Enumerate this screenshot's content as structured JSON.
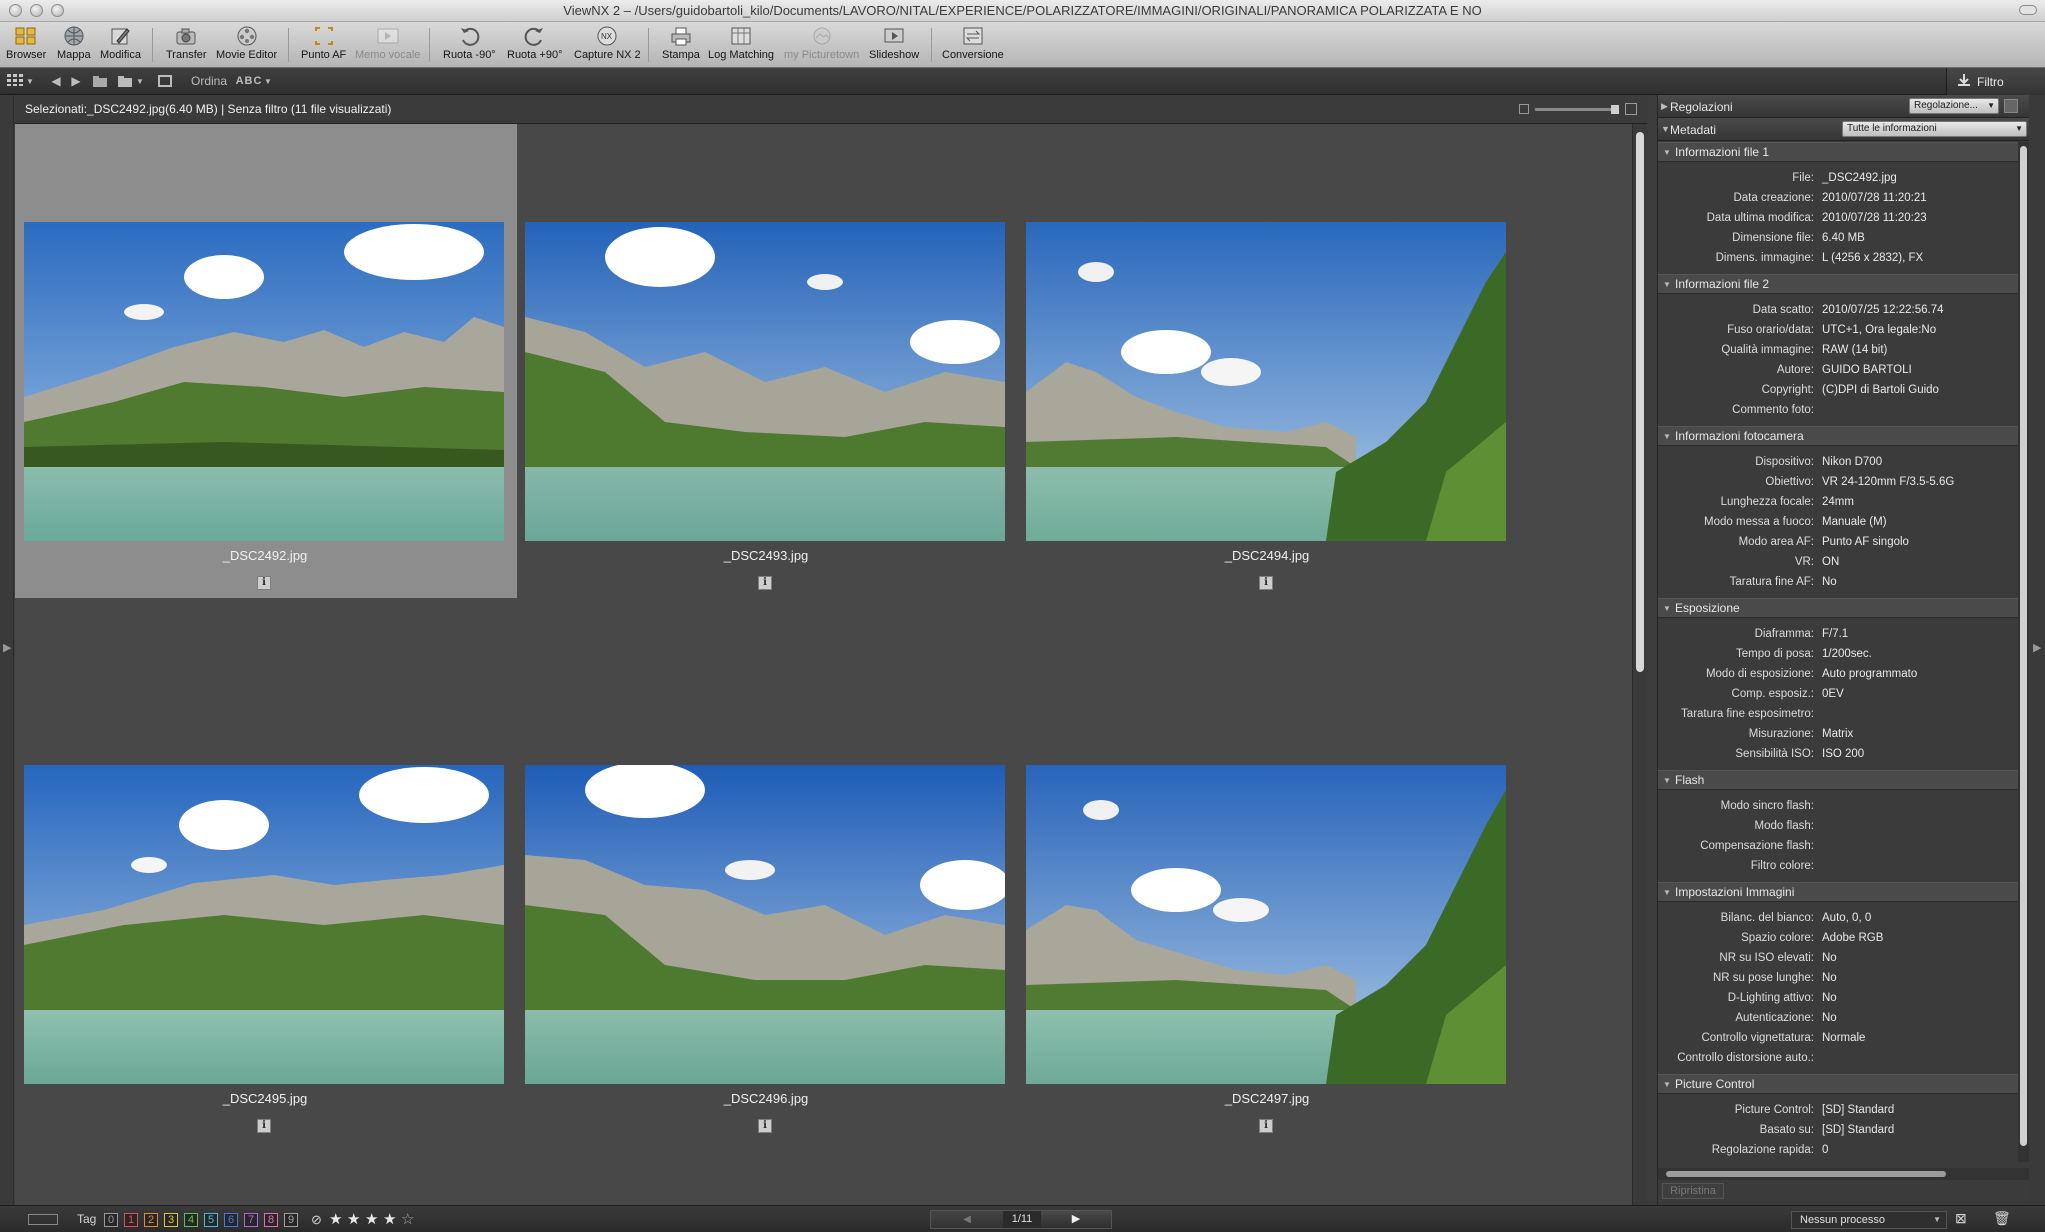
{
  "window": {
    "title": "ViewNX 2 – /Users/guidobartoli_kilo/Documents/LAVORO/NITAL/EXPERIENCE/POLARIZZATORE/IMMAGINI/ORIGINALI/PANORAMICA POLARIZZATA E NO"
  },
  "toolbar": {
    "browser": "Browser",
    "mappa": "Mappa",
    "modifica": "Modifica",
    "transfer": "Transfer",
    "movie_editor": "Movie Editor",
    "punto_af": "Punto AF",
    "memo_vocale": "Memo vocale",
    "ruota_left": "Ruota -90°",
    "ruota_right": "Ruota +90°",
    "capture_nx2": "Capture NX 2",
    "stampa": "Stampa",
    "log_matching": "Log Matching",
    "my_picturetown": "my Picturetown",
    "slideshow": "Slideshow",
    "conversione": "Conversione"
  },
  "toolbar2": {
    "ordina": "Ordina",
    "sort_value": "ABC",
    "filtro": "Filtro"
  },
  "content": {
    "selection_info": "Selezionati:_DSC2492.jpg(6.40 MB) | Senza filtro (11 file visualizzati)"
  },
  "thumbnails": [
    {
      "name": "_DSC2492.jpg",
      "selected": true
    },
    {
      "name": "_DSC2493.jpg",
      "selected": false
    },
    {
      "name": "_DSC2494.jpg",
      "selected": false
    },
    {
      "name": "_DSC2495.jpg",
      "selected": false
    },
    {
      "name": "_DSC2496.jpg",
      "selected": false
    },
    {
      "name": "_DSC2497.jpg",
      "selected": false
    }
  ],
  "panel": {
    "regolazioni": "Regolazioni",
    "regolazioni_dd": "Regolazione...",
    "metadati": "Metadati",
    "metadati_dd": "Tutte le informazioni",
    "sections": [
      {
        "title": "Informazioni file 1",
        "rows": [
          [
            "File:",
            "_DSC2492.jpg"
          ],
          [
            "Data creazione:",
            "2010/07/28 11:20:21"
          ],
          [
            "Data ultima modifica:",
            "2010/07/28 11:20:23"
          ],
          [
            "Dimensione file:",
            "6.40 MB"
          ],
          [
            "Dimens. immagine:",
            "L (4256 x 2832), FX"
          ]
        ]
      },
      {
        "title": "Informazioni file 2",
        "rows": [
          [
            "Data scatto:",
            "2010/07/25 12:22:56.74"
          ],
          [
            "Fuso orario/data:",
            "UTC+1, Ora legale:No"
          ],
          [
            "Qualità immagine:",
            "RAW (14 bit)"
          ],
          [
            "Autore:",
            "GUIDO BARTOLI"
          ],
          [
            "Copyright:",
            "(C)DPI di Bartoli Guido"
          ],
          [
            "Commento foto:",
            ""
          ]
        ]
      },
      {
        "title": "Informazioni fotocamera",
        "rows": [
          [
            "Dispositivo:",
            "Nikon D700"
          ],
          [
            "Obiettivo:",
            "VR 24-120mm F/3.5-5.6G"
          ],
          [
            "Lunghezza focale:",
            "24mm"
          ],
          [
            "Modo messa a fuoco:",
            "Manuale (M)"
          ],
          [
            "Modo area AF:",
            "Punto AF singolo"
          ],
          [
            "VR:",
            "ON"
          ],
          [
            "Taratura fine AF:",
            "No"
          ]
        ]
      },
      {
        "title": "Esposizione",
        "rows": [
          [
            "Diaframma:",
            "F/7.1"
          ],
          [
            "Tempo di posa:",
            "1/200sec."
          ],
          [
            "Modo di esposizione:",
            "Auto programmato"
          ],
          [
            "Comp. esposiz.:",
            "0EV"
          ],
          [
            "Taratura fine esposimetro:",
            ""
          ],
          [
            "Misurazione:",
            "Matrix"
          ],
          [
            "Sensibilità ISO:",
            "ISO 200"
          ]
        ]
      },
      {
        "title": "Flash",
        "rows": [
          [
            "Modo sincro flash:",
            ""
          ],
          [
            "Modo flash:",
            ""
          ],
          [
            "Compensazione flash:",
            ""
          ],
          [
            "Filtro colore:",
            ""
          ]
        ]
      },
      {
        "title": "Impostazioni Immagini",
        "rows": [
          [
            "Bilanc. del bianco:",
            "Auto, 0, 0"
          ],
          [
            "Spazio colore:",
            "Adobe RGB"
          ],
          [
            "NR su ISO elevati:",
            "No"
          ],
          [
            "NR su pose lunghe:",
            "No"
          ],
          [
            "D-Lighting attivo:",
            "No"
          ],
          [
            "Autenticazione:",
            "No"
          ],
          [
            "Controllo vignettatura:",
            "Normale"
          ],
          [
            "Controllo distorsione auto.:",
            ""
          ]
        ]
      },
      {
        "title": "Picture Control",
        "rows": [
          [
            "Picture Control:",
            "[SD] Standard"
          ],
          [
            "Basato su:",
            "[SD] Standard"
          ],
          [
            "Regolazione rapida:",
            "0"
          ]
        ]
      }
    ],
    "ripristina": "Ripristina"
  },
  "statusbar": {
    "tag_label": "Tag",
    "tags": [
      "0",
      "1",
      "2",
      "3",
      "4",
      "5",
      "6",
      "7",
      "8",
      "9"
    ],
    "tag_colors": [
      "#9a9a9a",
      "#e05050",
      "#e08a3a",
      "#d8c840",
      "#5cbf4e",
      "#4fb8d6",
      "#4a78e0",
      "#b068e0",
      "#e070b0",
      "#a0a0a0"
    ],
    "stars_count": 5,
    "stars_filled": 4,
    "page_counter": "1/11",
    "processo": "Nessun processo"
  }
}
